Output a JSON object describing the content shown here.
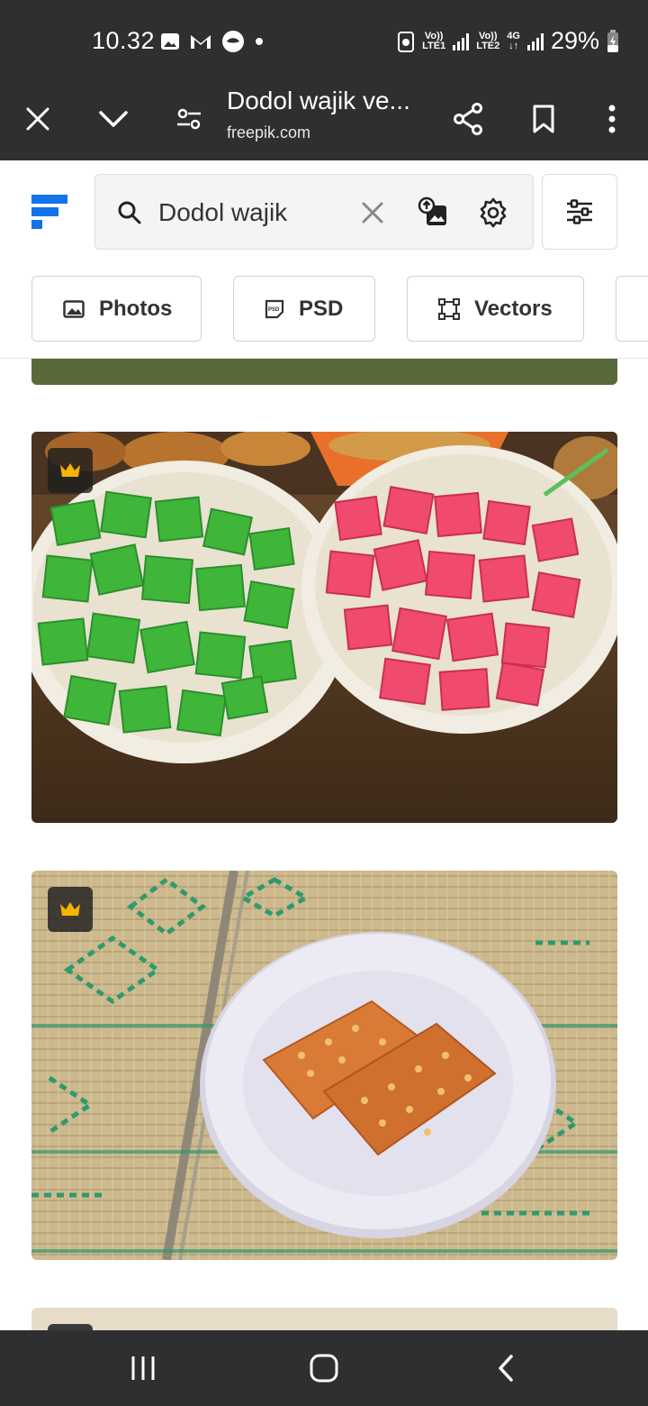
{
  "status_bar": {
    "time": "10.32",
    "net1": {
      "vo": "Vo))",
      "label": "LTE1"
    },
    "net2": {
      "vo": "Vo))",
      "label": "LTE2"
    },
    "net3": "4G",
    "battery": "29%"
  },
  "toolbar": {
    "page_title": "Dodol wajik ve...",
    "domain": "freepik.com"
  },
  "search": {
    "value": "Dodol wajik"
  },
  "chips": [
    {
      "label": "Photos"
    },
    {
      "label": "PSD"
    },
    {
      "label": "Vectors"
    }
  ],
  "colors": {
    "chrome": "#2e2f31",
    "brand_blue": "#1273eb",
    "premium_gold": "#f5b400",
    "banner_green": "#586a3a"
  }
}
